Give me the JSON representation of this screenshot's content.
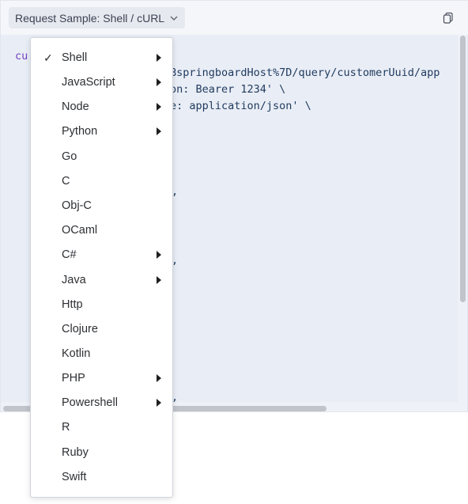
{
  "header": {
    "sample_label": "Request Sample: Shell / cURL",
    "chevron_icon": "chevron-down-icon",
    "copy_icon": "copy-icon"
  },
  "code": {
    "keyword_fragment": "cu",
    "visible_lines": [
      "Bspringboard​Host%7D/query/customerUuid/app",
      "on: Bearer 1234' \\",
      "e: application/json' \\",
      ",",
      ",",
      ","
    ]
  },
  "menu": {
    "items": [
      {
        "label": "Shell",
        "checked": true,
        "submenu": true
      },
      {
        "label": "JavaScript",
        "checked": false,
        "submenu": true
      },
      {
        "label": "Node",
        "checked": false,
        "submenu": true
      },
      {
        "label": "Python",
        "checked": false,
        "submenu": true
      },
      {
        "label": "Go",
        "checked": false,
        "submenu": false
      },
      {
        "label": "C",
        "checked": false,
        "submenu": false
      },
      {
        "label": "Obj-C",
        "checked": false,
        "submenu": false
      },
      {
        "label": "OCaml",
        "checked": false,
        "submenu": false
      },
      {
        "label": "C#",
        "checked": false,
        "submenu": true
      },
      {
        "label": "Java",
        "checked": false,
        "submenu": true
      },
      {
        "label": "Http",
        "checked": false,
        "submenu": false
      },
      {
        "label": "Clojure",
        "checked": false,
        "submenu": false
      },
      {
        "label": "Kotlin",
        "checked": false,
        "submenu": false
      },
      {
        "label": "PHP",
        "checked": false,
        "submenu": true
      },
      {
        "label": "Powershell",
        "checked": false,
        "submenu": true
      },
      {
        "label": "R",
        "checked": false,
        "submenu": false
      },
      {
        "label": "Ruby",
        "checked": false,
        "submenu": false
      },
      {
        "label": "Swift",
        "checked": false,
        "submenu": false
      }
    ],
    "check_glyph": "✓"
  },
  "colors": {
    "panel_bg": "#eef1f7",
    "code_text": "#1e3a5f",
    "keyword": "#6f42c1"
  }
}
